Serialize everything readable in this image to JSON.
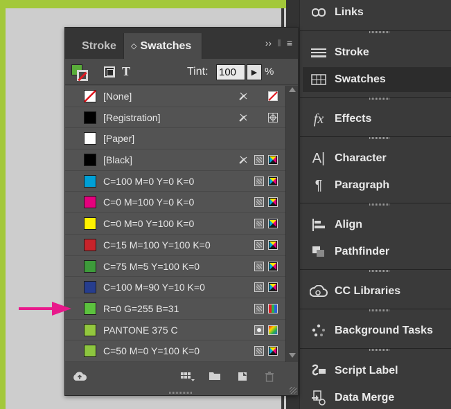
{
  "panel": {
    "tabs": [
      {
        "label": "Stroke"
      },
      {
        "label": "Swatches"
      }
    ],
    "tint_label": "Tint:",
    "tint_value": "100",
    "tint_unit": "%",
    "swatches": [
      {
        "name": "[None]",
        "color": "#ffffff",
        "type": "none"
      },
      {
        "name": "[Registration]",
        "color": "#000000",
        "type": "registration"
      },
      {
        "name": "[Paper]",
        "color": "#ffffff",
        "type": "paper"
      },
      {
        "name": "[Black]",
        "color": "#000000",
        "type": "black"
      },
      {
        "name": "C=100 M=0 Y=0 K=0",
        "color": "#00a0d6",
        "type": "cmyk"
      },
      {
        "name": "C=0 M=100 Y=0 K=0",
        "color": "#e5007d",
        "type": "cmyk"
      },
      {
        "name": "C=0 M=0 Y=100 K=0",
        "color": "#fff200",
        "type": "cmyk"
      },
      {
        "name": "C=15 M=100 Y=100 K=0",
        "color": "#c8232a",
        "type": "cmyk"
      },
      {
        "name": "C=75 M=5 Y=100 K=0",
        "color": "#3d9b3a",
        "type": "cmyk"
      },
      {
        "name": "C=100 M=90 Y=10 K=0",
        "color": "#263d8e",
        "type": "cmyk"
      },
      {
        "name": "R=0 G=255 B=31",
        "color": "#5cc23e",
        "type": "rgb"
      },
      {
        "name": "PANTONE 375 C",
        "color": "#93c83e",
        "type": "spot"
      },
      {
        "name": "C=50 M=0 Y=100 K=0",
        "color": "#8dc63f",
        "type": "cmyk"
      }
    ]
  },
  "dock": [
    {
      "label": "Links",
      "icon": "links-icon"
    },
    {
      "label": "Stroke",
      "icon": "stroke-icon"
    },
    {
      "label": "Swatches",
      "icon": "swatches-icon"
    },
    {
      "label": "Effects",
      "icon": "effects-icon"
    },
    {
      "label": "Character",
      "icon": "character-icon"
    },
    {
      "label": "Paragraph",
      "icon": "paragraph-icon"
    },
    {
      "label": "Align",
      "icon": "align-icon"
    },
    {
      "label": "Pathfinder",
      "icon": "pathfinder-icon"
    },
    {
      "label": "CC Libraries",
      "icon": "cc-libraries-icon"
    },
    {
      "label": "Background Tasks",
      "icon": "background-tasks-icon"
    },
    {
      "label": "Script Label",
      "icon": "script-label-icon"
    },
    {
      "label": "Data Merge",
      "icon": "data-merge-icon"
    }
  ],
  "colors": {
    "frame": "#a3c83a",
    "panel_bg": "#4b4b4b",
    "dock_bg": "#3a3a3a",
    "annotation_arrow": "#e8198b"
  }
}
